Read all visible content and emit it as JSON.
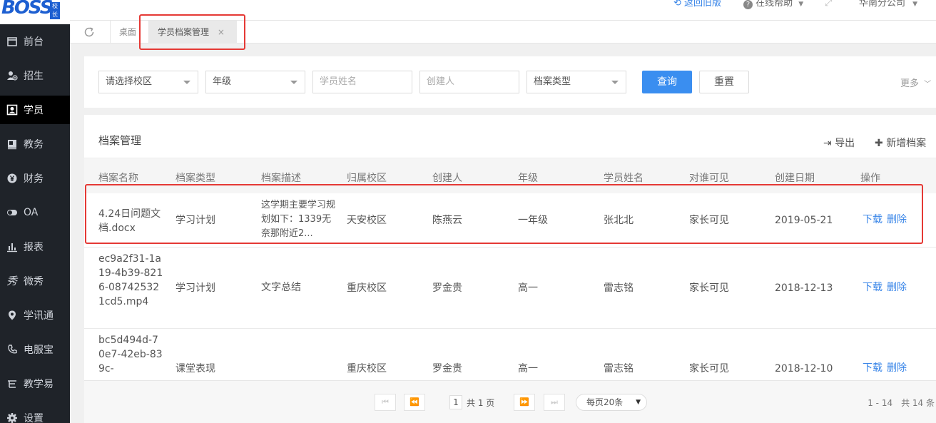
{
  "logo": {
    "text": "BOSS",
    "badge": "校长"
  },
  "sidebar": {
    "items": [
      {
        "label": "前台",
        "icon": "calendar-icon"
      },
      {
        "label": "招生",
        "icon": "user-add-icon"
      },
      {
        "label": "学员",
        "icon": "id-card-icon",
        "active": true
      },
      {
        "label": "教务",
        "icon": "book-icon"
      },
      {
        "label": "财务",
        "icon": "yen-icon"
      },
      {
        "label": "OA",
        "icon": "toggle-icon"
      },
      {
        "label": "报表",
        "icon": "bar-chart-icon"
      },
      {
        "label": "微秀",
        "icon": "xiu-icon"
      },
      {
        "label": "学讯通",
        "icon": "location-icon"
      },
      {
        "label": "电服宝",
        "icon": "phone-icon"
      },
      {
        "label": "教学易",
        "icon": "edu-icon"
      },
      {
        "label": "设置",
        "icon": "gear-icon"
      }
    ]
  },
  "header": {
    "old_version": "返回旧版",
    "help": "在线帮助",
    "company": "华南分公司"
  },
  "tabs": [
    {
      "label": "桌面"
    },
    {
      "label": "学员档案管理"
    }
  ],
  "filters": {
    "campus": "请选择校区",
    "grade": "年级",
    "student_name_placeholder": "学员姓名",
    "creator_placeholder": "创建人",
    "archive_type": "档案类型",
    "query": "查询",
    "reset": "重置",
    "more": "更多"
  },
  "panel": {
    "title": "档案管理",
    "export": "导出",
    "add": "新增档案"
  },
  "table": {
    "headers": [
      "档案名称",
      "档案类型",
      "档案描述",
      "归属校区",
      "创建人",
      "年级",
      "学员姓名",
      "对谁可见",
      "创建日期",
      "操作"
    ],
    "rows": [
      {
        "name": "4.24日问题文档.docx",
        "type": "学习计划",
        "desc": "这学期主要学习规划如下：1339无奈那附近2...",
        "campus": "天安校区",
        "creator": "陈燕云",
        "grade": "一年级",
        "student": "张北北",
        "visible": "家长可见",
        "date": "2019-05-21",
        "download": "下载",
        "delete": "删除"
      },
      {
        "name": "ec9a2f31-1a19-4b39-8216-087425321cd5.mp4",
        "type": "学习计划",
        "desc": "文字总结",
        "campus": "重庆校区",
        "creator": "罗金贵",
        "grade": "高一",
        "student": "雷志铭",
        "visible": "家长可见",
        "date": "2018-12-13",
        "download": "下载",
        "delete": "删除"
      },
      {
        "name": "bc5d494d-70e7-42eb-839c-",
        "type": "课堂表现",
        "desc": "",
        "campus": "重庆校区",
        "creator": "罗金贵",
        "grade": "高一",
        "student": "雷志铭",
        "visible": "家长可见",
        "date": "2018-12-10",
        "download": "下载",
        "delete": "删除"
      }
    ]
  },
  "pager": {
    "current": "1",
    "total": "共 1 页",
    "size": "每页20条",
    "info": "1 - 14　共 14 条"
  },
  "colors": {
    "accent": "#3a8ef0",
    "sidebar": "#1f2329",
    "highlight": "#e53935"
  }
}
